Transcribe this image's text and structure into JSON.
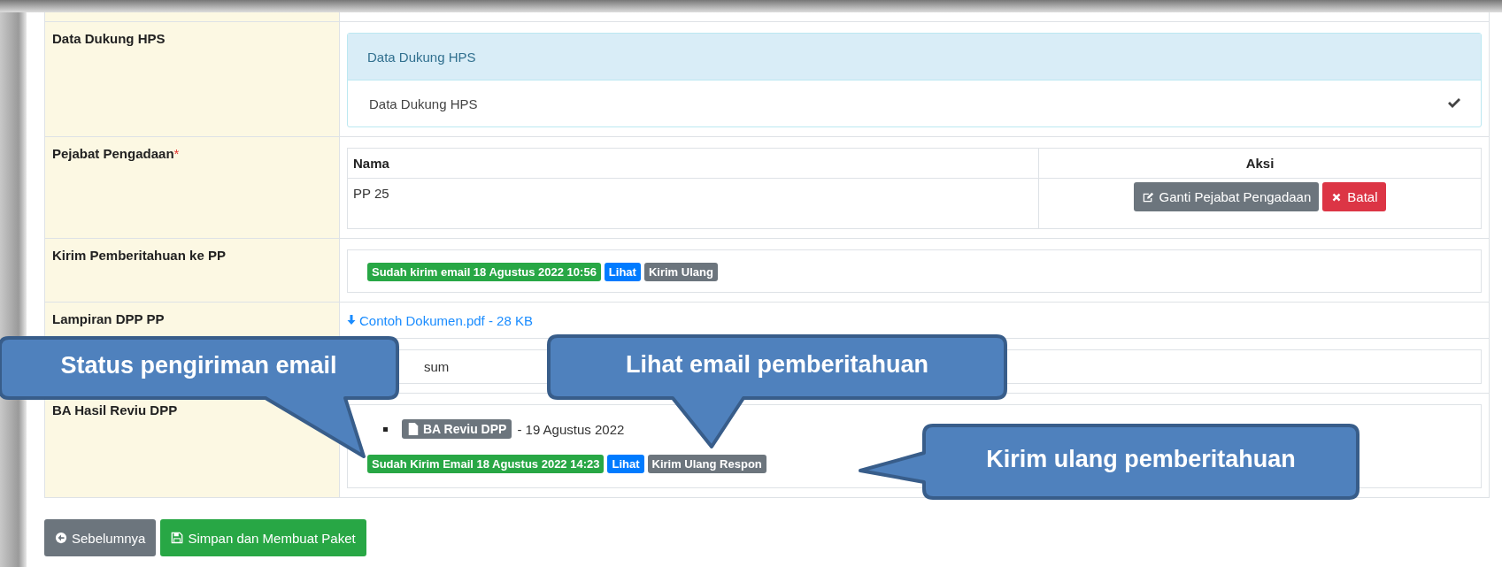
{
  "form_rows": [
    {
      "kind": "panel",
      "label": "Data Dukung HPS",
      "panel": {
        "heading": "Data Dukung HPS",
        "item": "Data Dukung HPS",
        "checked": true
      }
    },
    {
      "kind": "officials",
      "label": "Pejabat Pengadaan",
      "required_mark": "*",
      "columns": [
        "Nama",
        "Aksi"
      ],
      "rows": [
        {
          "name": "PP 25",
          "actions": [
            {
              "label": "Ganti Pejabat Pengadaan",
              "kind": "edit"
            },
            {
              "label": "Batal",
              "kind": "cancel"
            }
          ]
        }
      ]
    },
    {
      "kind": "notify",
      "label": "Kirim Pemberitahuan ke PP",
      "badges": [
        {
          "text": "Sudah kirim email 18 Agustus 2022 10:56",
          "kind": "success"
        },
        {
          "text": "Lihat",
          "kind": "primary"
        },
        {
          "text": "Kirim Ulang",
          "kind": "secondary"
        }
      ]
    },
    {
      "kind": "file",
      "label": "Lampiran DPP PP",
      "link": "Contoh Dokumen.pdf - 28 KB"
    },
    {
      "kind": "text",
      "value": "sum"
    },
    {
      "kind": "review",
      "label": "BA Hasil Reviu DPP",
      "documents": [
        {
          "name": "BA Reviu DPP",
          "date": "- 19 Agustus 2022"
        }
      ],
      "badges": [
        {
          "text": "Sudah Kirim Email 18 Agustus 2022 14:23",
          "kind": "success"
        },
        {
          "text": "Lihat",
          "kind": "primary"
        },
        {
          "text": "Kirim Ulang Respon",
          "kind": "secondary"
        }
      ]
    }
  ],
  "buttons": [
    {
      "label": "Sebelumnya",
      "kind": "back"
    },
    {
      "label": "Simpan dan Membuat Paket",
      "kind": "save"
    }
  ],
  "callouts": [
    {
      "text": "Status pengiriman email"
    },
    {
      "text": "Lihat email pemberitahuan"
    },
    {
      "text": "Kirim ulang pemberitahuan"
    }
  ]
}
